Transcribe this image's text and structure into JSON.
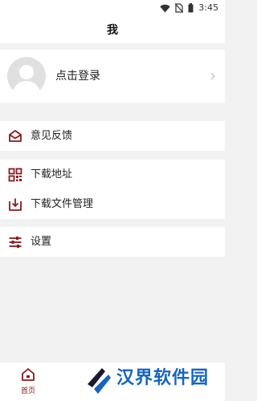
{
  "status_bar": {
    "time": "3:45",
    "icons": [
      "wifi-icon",
      "no-sim-icon",
      "battery-icon"
    ]
  },
  "header": {
    "title": "我"
  },
  "profile": {
    "login_label": "点击登录",
    "avatar_icon": "default-avatar-icon"
  },
  "menu": {
    "feedback": {
      "label": "意见反馈",
      "icon": "mail-icon"
    },
    "download_address": {
      "label": "下载地址",
      "icon": "qr-code-icon"
    },
    "download_manager": {
      "label": "下载文件管理",
      "icon": "download-icon"
    },
    "settings": {
      "label": "设置",
      "icon": "sliders-icon"
    }
  },
  "bottom_nav": {
    "home_label": "首页",
    "home_icon": "home-icon"
  },
  "watermark": {
    "text": "汉界软件园"
  },
  "colors": {
    "accent": "#8b1a1a",
    "background": "#f2f2f2",
    "watermark": "#1565c0"
  }
}
